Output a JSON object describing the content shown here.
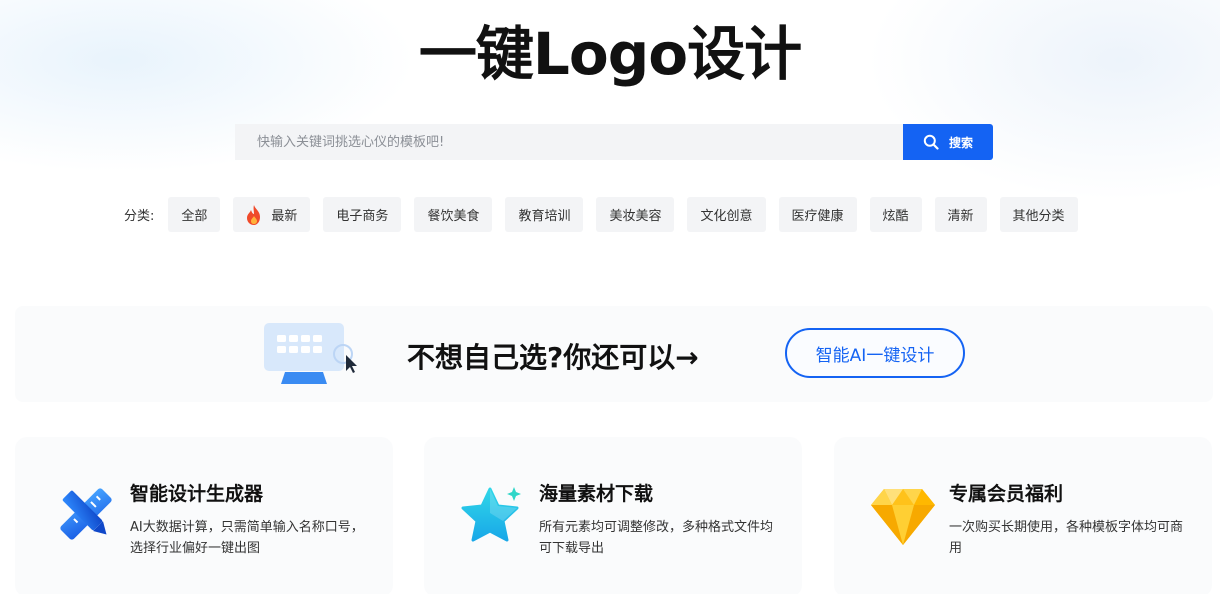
{
  "page": {
    "title": "一键Logo设计"
  },
  "search": {
    "placeholder": "快输入关键词挑选心仪的模板吧!",
    "button_label": "搜索"
  },
  "categories": {
    "label": "分类:",
    "items": [
      {
        "label": "全部"
      },
      {
        "label": "最新",
        "icon": "flame-icon"
      },
      {
        "label": "电子商务"
      },
      {
        "label": "餐饮美食"
      },
      {
        "label": "教育培训"
      },
      {
        "label": "美妆美容"
      },
      {
        "label": "文化创意"
      },
      {
        "label": "医疗健康"
      },
      {
        "label": "炫酷"
      },
      {
        "label": "清新"
      },
      {
        "label": "其他分类"
      }
    ]
  },
  "promo": {
    "text": "不想自己选?你还可以→",
    "button_label": "智能AI一键设计",
    "illustration": "keyboard-monitor-cursor-icon"
  },
  "features": [
    {
      "title": "智能设计生成器",
      "desc": "AI大数据计算，只需简单输入名称口号，选择行业偏好一键出图",
      "icon": "ruler-pencil-icon"
    },
    {
      "title": "海量素材下载",
      "desc": "所有元素均可调整修改，多种格式文件均可下载导出",
      "icon": "star-icon"
    },
    {
      "title": "专属会员福利",
      "desc": "一次购买长期使用，各种模板字体均可商用",
      "icon": "diamond-icon"
    }
  ],
  "colors": {
    "accent": "#1463f3",
    "chip_bg": "#f3f4f6",
    "card_bg": "#fafbfc",
    "flame": "#f04a2a",
    "gold": "#ffc21a"
  }
}
